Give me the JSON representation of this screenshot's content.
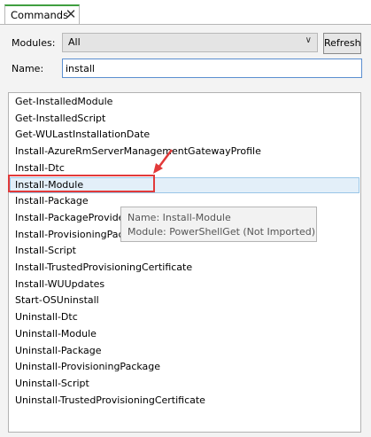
{
  "tab": {
    "title": "Commands",
    "close_glyph": "✕"
  },
  "filters": {
    "modules_label": "Modules:",
    "modules_value": "All",
    "refresh_label": "Refresh",
    "name_label": "Name:",
    "name_value": "install"
  },
  "commands": [
    "Get-InstalledModule",
    "Get-InstalledScript",
    "Get-WULastInstallationDate",
    "Install-AzureRmServerManagementGatewayProfile",
    "Install-Dtc",
    "Install-Module",
    "Install-Package",
    "Install-PackageProvider",
    "Install-ProvisioningPackage",
    "Install-Script",
    "Install-TrustedProvisioningCertificate",
    "Install-WUUpdates",
    "Start-OSUninstall",
    "Uninstall-Dtc",
    "Uninstall-Module",
    "Uninstall-Package",
    "Uninstall-ProvisioningPackage",
    "Uninstall-Script",
    "Uninstall-TrustedProvisioningCertificate"
  ],
  "selected_command": "Install-Module",
  "tooltip": {
    "name_line": "Name: Install-Module",
    "module_line": "Module: PowerShellGet (Not Imported)"
  },
  "colors": {
    "highlight_box": "#e23a3a",
    "selection_bg": "#e3eff9",
    "tab_accent": "#3f9f3f"
  }
}
